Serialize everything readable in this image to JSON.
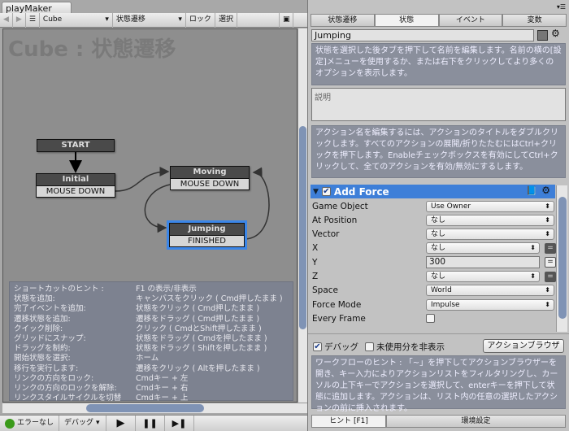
{
  "window": {
    "title": "playMaker"
  },
  "toolbar": {
    "back": "◀",
    "forward": "▶",
    "menu": "☰",
    "object": "Cube",
    "fsm": "状態遷移",
    "lock": "ロック",
    "select": "選択"
  },
  "canvas": {
    "title": "Cube : 状態遷移",
    "nodes": {
      "start": "START",
      "initial": {
        "name": "Initial",
        "event": "MOUSE DOWN"
      },
      "moving": {
        "name": "Moving",
        "event": "MOUSE DOWN"
      },
      "jumping": {
        "name": "Jumping",
        "event": "FINISHED"
      }
    },
    "shortcuts": [
      {
        "k": "ショートカットのヒント :",
        "v": "F1 の表示/非表示"
      },
      {
        "k": "状態を追加:",
        "v": "キャンバスをクリック ( Cmd押したまま )"
      },
      {
        "k": "完了イベントを追加:",
        "v": "状態をクリック ( Cmd押したまま )"
      },
      {
        "k": "遷移状態を追加:",
        "v": "遷移をドラッグ ( Cmd押したまま )"
      },
      {
        "k": "クイック削除:",
        "v": "クリック ( CmdとShift押したまま )"
      },
      {
        "k": "グリッドにスナップ:",
        "v": "状態をドラッグ ( Cmdを押したまま )"
      },
      {
        "k": "ドラッグを制約:",
        "v": "状態をドラッグ ( Shiftを押したまま )"
      },
      {
        "k": " 開始状態を選択:",
        "v": "ホーム"
      },
      {
        "k": "移行を実行します:",
        "v": "遷移をクリック ( Altを押したまま )"
      },
      {
        "k": "リンクの方向をロック:",
        "v": "Cmdキー + 左"
      },
      {
        "k": "リンクの方向のロックを解除:",
        "v": "Cmdキー + 右"
      },
      {
        "k": "リンクスタイルサイクルを切替",
        "v": "Cmdキー + 上"
      }
    ]
  },
  "bottombar": {
    "status": "エラーなし",
    "status_color": "#3a9a1a",
    "debug": "デバッグ",
    "play": "▶",
    "pause": "❚❚",
    "step": "▶❚"
  },
  "inspector": {
    "tabs": [
      {
        "label": "状態遷移"
      },
      {
        "label": "状態",
        "active": true
      },
      {
        "label": "イベント"
      },
      {
        "label": "変数"
      }
    ],
    "state_name": "Jumping",
    "state_hint": "状態を選択した後タブを押下して名前を編集します。名前の横の[設定]メニューを使用するか、または右下をクリックしてより多くのオプションを表示します。",
    "description_placeholder": "説明",
    "action_hint": "アクション名を編集するには、アクションのタイトルをダブルクリックします。すべてのアクションの展開/折りたたむにはCtrl+クリックを押下します。Enableチェックボックスを有効にしてCtrl+クリックして、全てのアクションを有効/無効にするします。",
    "action": {
      "title": "Add Force",
      "enabled": true,
      "accent": "#3e7fd8",
      "params": [
        {
          "label": "Game Object",
          "value": "Use Owner",
          "type": "dropdown"
        },
        {
          "label": "At Position",
          "value": "なし",
          "type": "dropdown"
        },
        {
          "label": "Vector",
          "value": "なし",
          "type": "dropdown"
        },
        {
          "label": "X",
          "value": "なし",
          "type": "dropdown-var"
        },
        {
          "label": "Y",
          "value": "300",
          "type": "input"
        },
        {
          "label": "Z",
          "value": "なし",
          "type": "dropdown-var"
        },
        {
          "label": "Space",
          "value": "World",
          "type": "dropdown"
        },
        {
          "label": "Force Mode",
          "value": "Impulse",
          "type": "dropdown"
        },
        {
          "label": "Every Frame",
          "value": false,
          "type": "checkbox"
        }
      ]
    },
    "debug_label": "デバッグ",
    "debug_checked": true,
    "hide_unused_label": "未使用分を非表示",
    "hide_unused_checked": false,
    "action_browser": "アクションブラウザ",
    "workflow_hint": "ワークフローのヒント : 「~」を押下してアクションブラウザーを開き、キー入力によりアクションリストをフィルタリングし、カーソルの上下キーでアクションを選択して、enterキーを押下して状態に追加します。アクションは、リスト内の任意の選択したアクションの前に挿入されます。",
    "bottom_tabs": [
      {
        "label": "ヒント [F1]",
        "active": true
      },
      {
        "label": "環境設定"
      }
    ]
  }
}
